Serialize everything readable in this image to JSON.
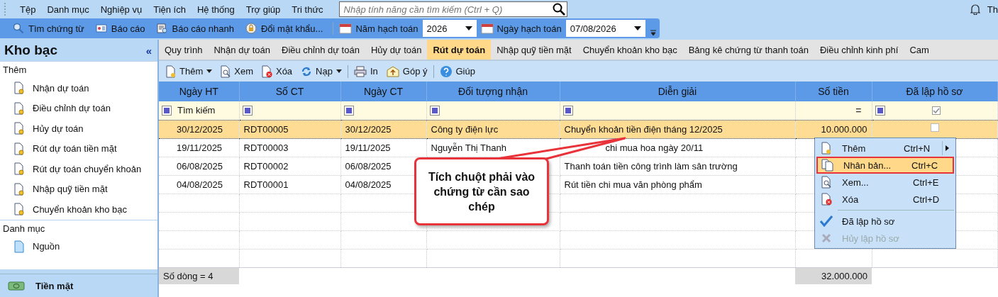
{
  "menu_bar": {
    "items": [
      "Tệp",
      "Danh mục",
      "Nghiệp vụ",
      "Tiện ích",
      "Hệ thống",
      "Trợ giúp",
      "Tri thức"
    ],
    "search": {
      "placeholder": "Nhập tính năng cần tìm kiếm (Ctrl + Q)"
    },
    "user": "Th"
  },
  "toolbar": {
    "buttons": [
      {
        "label": "Tìm chứng từ",
        "kind": "search"
      },
      {
        "label": "Báo cáo",
        "kind": "report"
      },
      {
        "label": "Báo cáo nhanh",
        "kind": "quick"
      },
      {
        "label": "Đổi mật khẩu...",
        "kind": "password"
      }
    ],
    "year": {
      "label": "Năm hạch toán",
      "value": "2026"
    },
    "date": {
      "label": "Ngày hạch toán",
      "value": "07/08/2026"
    }
  },
  "sidebar": {
    "title": "Kho bạc",
    "collapse": "«",
    "sections": [
      {
        "title": "Thêm",
        "items": [
          {
            "label": "Nhận dự toán",
            "kind": "form"
          },
          {
            "label": "Điều chỉnh dự toán",
            "kind": "form"
          },
          {
            "label": "Hủy dự toán",
            "kind": "form"
          },
          {
            "label": "Rút dự toán tiền mặt",
            "kind": "form"
          },
          {
            "label": "Rút dự toán chuyển khoản",
            "kind": "form"
          },
          {
            "label": "Nhập quỹ tiền mặt",
            "kind": "form"
          },
          {
            "label": "Chuyển khoản kho bạc",
            "kind": "form"
          }
        ]
      },
      {
        "title": "Danh mục",
        "items": [
          {
            "label": "Nguồn",
            "kind": "catalog"
          }
        ]
      }
    ],
    "bottom": "Tiền mặt"
  },
  "tabs": [
    {
      "label": "Quy trình",
      "selected": false
    },
    {
      "label": "Nhận dự toán",
      "selected": false
    },
    {
      "label": "Điều chỉnh dự toán",
      "selected": false
    },
    {
      "label": "Hủy dự toán",
      "selected": false
    },
    {
      "label": "Rút dự toán",
      "selected": true
    },
    {
      "label": "Nhập quỹ tiền mặt",
      "selected": false
    },
    {
      "label": "Chuyển khoản kho bạc",
      "selected": false
    },
    {
      "label": "Bảng kê chứng từ thanh toán",
      "selected": false
    },
    {
      "label": "Điều chỉnh kinh phí",
      "selected": false
    },
    {
      "label": "Cam",
      "selected": false
    }
  ],
  "actions": [
    {
      "label": "Thêm",
      "kind": "add",
      "dropdown": true
    },
    {
      "label": "Xem",
      "kind": "view",
      "dropdown": false
    },
    {
      "label": "Xóa",
      "kind": "delete",
      "dropdown": false
    },
    {
      "label": "Nạp",
      "kind": "reload",
      "dropdown": true
    },
    {
      "label": "In",
      "kind": "print",
      "dropdown": false
    },
    {
      "label": "Góp ý",
      "kind": "feedback",
      "dropdown": false
    },
    {
      "label": "Giúp",
      "kind": "help",
      "dropdown": false
    }
  ],
  "table": {
    "columns": [
      "Ngày HT",
      "Số CT",
      "Ngày CT",
      "Đối tượng nhận",
      "Diễn giải",
      "Số tiền",
      "Đã lập hồ sơ"
    ],
    "filter": {
      "placeholder": "Tìm kiếm",
      "amount_operator": "=",
      "checked": true
    },
    "rows": [
      {
        "cells": [
          "30/12/2025",
          "RDT00005",
          "30/12/2025",
          "Công ty điện lực",
          "Chuyển khoản tiền điện tháng 12/2025",
          "10.000.000"
        ],
        "selected": true,
        "checked": false
      },
      {
        "cells": [
          "19/11/2025",
          "RDT00003",
          "19/11/2025",
          "Nguyễn Thị Thanh",
          "chi mua hoa ngày 20/11"
        ],
        "selected": false
      },
      {
        "cells": [
          "06/08/2025",
          "RDT00002",
          "06/08/2025",
          "",
          "Thanh toán tiền công trình làm sân trường"
        ],
        "selected": false
      },
      {
        "cells": [
          "04/08/2025",
          "RDT00001",
          "04/08/2025",
          "",
          "Rút tiền chi mua văn phòng phẩm"
        ],
        "selected": false
      }
    ],
    "summary": {
      "count": "Số dòng = 4",
      "total": "32.000.000"
    }
  },
  "context_menu": [
    {
      "kind": "add",
      "label": "Thêm",
      "shortcut": "Ctrl+N",
      "submenu": true,
      "selected": false,
      "disabled": false
    },
    {
      "kind": "copy",
      "label": "Nhân bản...",
      "shortcut": "Ctrl+C",
      "submenu": false,
      "selected": true,
      "disabled": false
    },
    {
      "kind": "view",
      "label": "Xem...",
      "shortcut": "Ctrl+E",
      "submenu": false,
      "selected": false,
      "disabled": false
    },
    {
      "kind": "delete",
      "label": "Xóa",
      "shortcut": "Ctrl+D",
      "submenu": false,
      "selected": false,
      "disabled": false
    },
    {
      "kind": "separator"
    },
    {
      "kind": "mark",
      "label": "Đã lập hồ sơ",
      "submenu": false,
      "selected": false,
      "disabled": false
    },
    {
      "kind": "unmark",
      "label": "Hủy lập hồ sơ",
      "submenu": false,
      "selected": false,
      "disabled": true
    }
  ],
  "callout": {
    "text": "Tích chuột phải vào chứng từ cần sao chép"
  }
}
